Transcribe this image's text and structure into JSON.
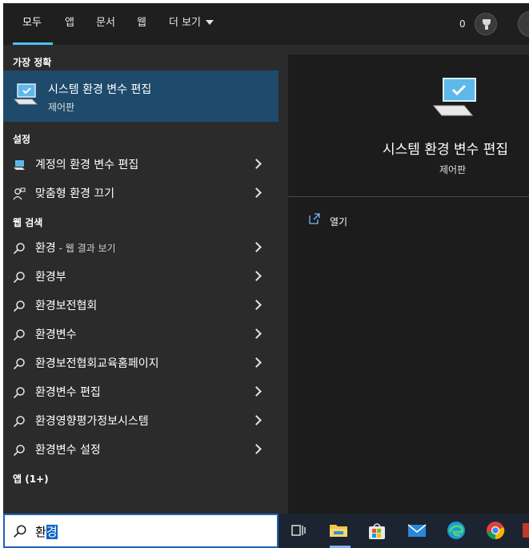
{
  "tabs": [
    {
      "label": "모두"
    },
    {
      "label": "앱"
    },
    {
      "label": "문서"
    },
    {
      "label": "웹"
    },
    {
      "label": "더 보기"
    }
  ],
  "header": {
    "points": "0"
  },
  "sections": {
    "best_match": "가장 정확",
    "settings": "설정",
    "web_search": "웹 검색",
    "apps": "앱 (1+)"
  },
  "best_match": {
    "title": "시스템 환경 변수 편집",
    "subtitle": "제어판"
  },
  "settings_items": [
    {
      "label": "계정의 환경 변수 편집"
    },
    {
      "label": "맞춤형 환경 끄기"
    }
  ],
  "web_items": [
    {
      "label": "환경",
      "hint": " - 웹 결과 보기"
    },
    {
      "label": "환경부",
      "hint": ""
    },
    {
      "label": "환경보전협회",
      "hint": ""
    },
    {
      "label": "환경변수",
      "hint": ""
    },
    {
      "label": "환경보전협회교육홈페이지",
      "hint": ""
    },
    {
      "label": "환경변수 편집",
      "hint": ""
    },
    {
      "label": "환경영향평가정보시스템",
      "hint": ""
    },
    {
      "label": "환경변수 설정",
      "hint": ""
    }
  ],
  "detail": {
    "title": "시스템 환경 변수 편집",
    "subtitle": "제어판",
    "open_label": "열기"
  },
  "search": {
    "typed": "환",
    "selected": "경"
  },
  "taskbar": [
    "task-view-icon",
    "file-explorer-icon",
    "store-icon",
    "mail-icon",
    "edge-icon",
    "chrome-icon"
  ],
  "colors": {
    "accent": "#4cc2ff",
    "highlight": "#1e4a6b",
    "search_border": "#1f63b3"
  }
}
